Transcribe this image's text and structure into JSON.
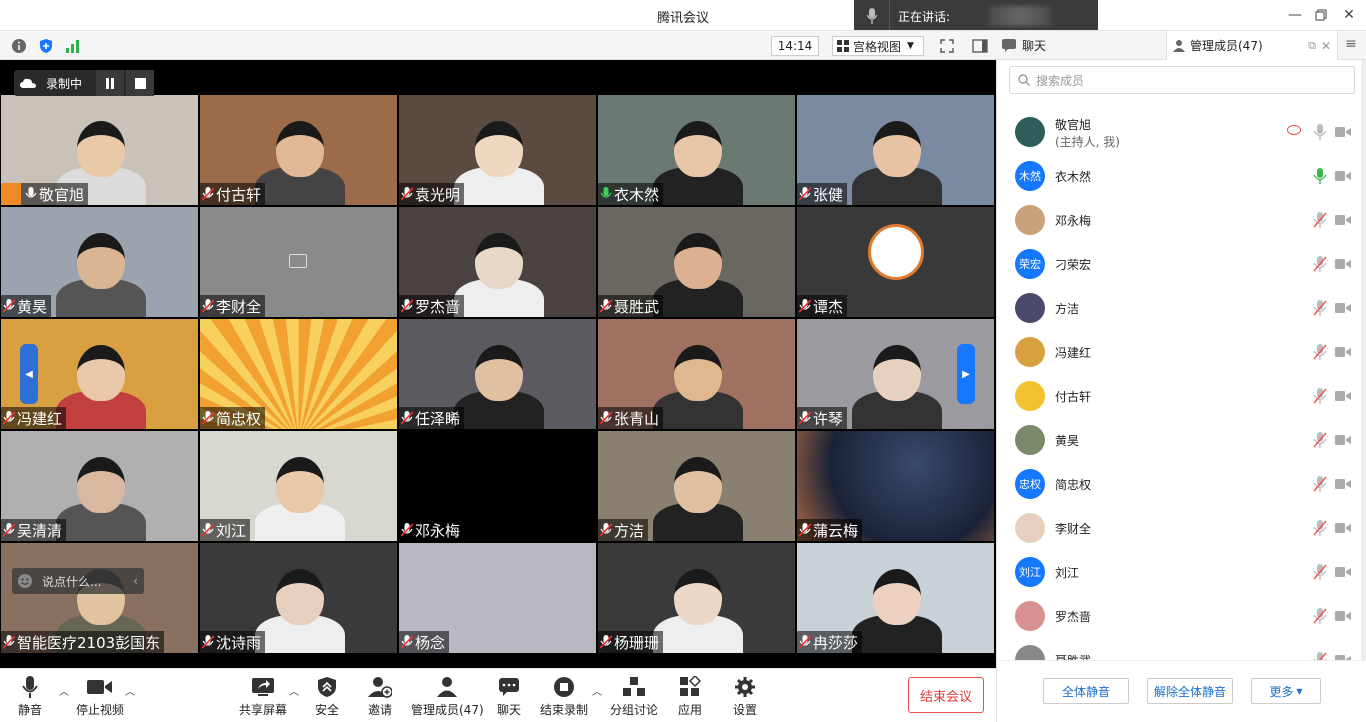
{
  "window": {
    "title": "腾讯会议"
  },
  "speaker": {
    "label": "正在讲话:"
  },
  "toolbar": {
    "time": "14:14",
    "view_label": "宫格视图"
  },
  "recording": {
    "label": "录制中"
  },
  "panel": {
    "chat_tab": "聊天",
    "members_tab": "管理成员(47)",
    "search_placeholder": "搜索成员"
  },
  "tiles": [
    {
      "name": "敬官旭",
      "host": true
    },
    {
      "name": "付古轩"
    },
    {
      "name": "袁光明"
    },
    {
      "name": "衣木然",
      "active": true
    },
    {
      "name": "张健"
    },
    {
      "name": "黄昊"
    },
    {
      "name": "李财全"
    },
    {
      "name": "罗杰啬"
    },
    {
      "name": "聂胜武"
    },
    {
      "name": "谭杰"
    },
    {
      "name": "冯建红"
    },
    {
      "name": "简忠权"
    },
    {
      "name": "任泽睎"
    },
    {
      "name": "张青山"
    },
    {
      "name": "许琴"
    },
    {
      "name": "吴清清"
    },
    {
      "name": "刘江"
    },
    {
      "name": "邓永梅"
    },
    {
      "name": "方洁"
    },
    {
      "name": "蒲云梅"
    },
    {
      "name": "智能医疗2103彭国东"
    },
    {
      "name": "沈诗雨"
    },
    {
      "name": "杨念"
    },
    {
      "name": "杨珊珊"
    },
    {
      "name": "冉莎莎"
    }
  ],
  "chat_hint": "说点什么...",
  "bottom": {
    "mute": "静音",
    "stop_video": "停止视频",
    "share": "共享屏幕",
    "security": "安全",
    "invite": "邀请",
    "members": "管理成员(47)",
    "chat": "聊天",
    "end_record": "结束录制",
    "breakout": "分组讨论",
    "apps": "应用",
    "settings": "设置",
    "end_meeting": "结束会议"
  },
  "members": [
    {
      "name": "敬官旭",
      "sub": "(主持人, 我)",
      "avatar": "img",
      "color": "#2f5d5a"
    },
    {
      "name": "衣木然",
      "avatar": "木然",
      "color": "#1677ff",
      "speaking": true
    },
    {
      "name": "邓永梅",
      "avatar": "img",
      "color": "#c9a27a"
    },
    {
      "name": "刁荣宏",
      "avatar": "荣宏",
      "color": "#1677ff"
    },
    {
      "name": "方洁",
      "avatar": "img",
      "color": "#4a4a6a"
    },
    {
      "name": "冯建红",
      "avatar": "img",
      "color": "#d9a040"
    },
    {
      "name": "付古轩",
      "avatar": "img",
      "color": "#f2c230"
    },
    {
      "name": "黄昊",
      "avatar": "img",
      "color": "#7a8a6a"
    },
    {
      "name": "简忠权",
      "avatar": "忠权",
      "color": "#1677ff"
    },
    {
      "name": "李财全",
      "avatar": "img",
      "color": "#e8d0c0"
    },
    {
      "name": "刘江",
      "avatar": "刘江",
      "color": "#1677ff"
    },
    {
      "name": "罗杰啬",
      "avatar": "img",
      "color": "#d89090"
    },
    {
      "name": "聂胜武",
      "avatar": "img",
      "color": "#888"
    }
  ],
  "member_footer": {
    "mute_all": "全体静音",
    "unmute_all": "解除全体静音",
    "more": "更多"
  }
}
